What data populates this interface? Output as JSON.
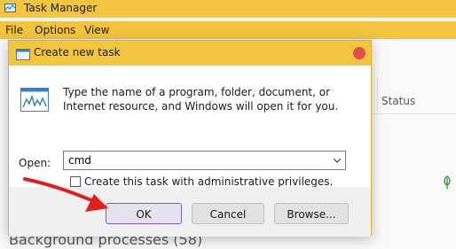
{
  "taskmanager": {
    "title": "Task Manager",
    "menu": [
      "File",
      "Options",
      "View"
    ],
    "status_header": "Status",
    "background_processes": "Background processes (58)"
  },
  "dialog": {
    "title": "Create new task",
    "description": "Type the name of a program, folder, document, or Internet resource, and Windows will open it for you.",
    "open_label": "Open:",
    "open_value": "cmd",
    "admin_checkbox_label": "Create this task with administrative privileges.",
    "admin_checked": false,
    "buttons": {
      "ok": "OK",
      "cancel": "Cancel",
      "browse": "Browse..."
    }
  },
  "colors": {
    "titlebar": "#f3c43e",
    "close_button": "#e2504b",
    "annotation_arrow": "#e02020",
    "ok_focus_border": "#7b5dbd"
  },
  "icons": [
    "app-icon",
    "run-icon",
    "close-icon",
    "dropdown-chevron-icon",
    "leaf-icon",
    "annotation-arrow"
  ]
}
